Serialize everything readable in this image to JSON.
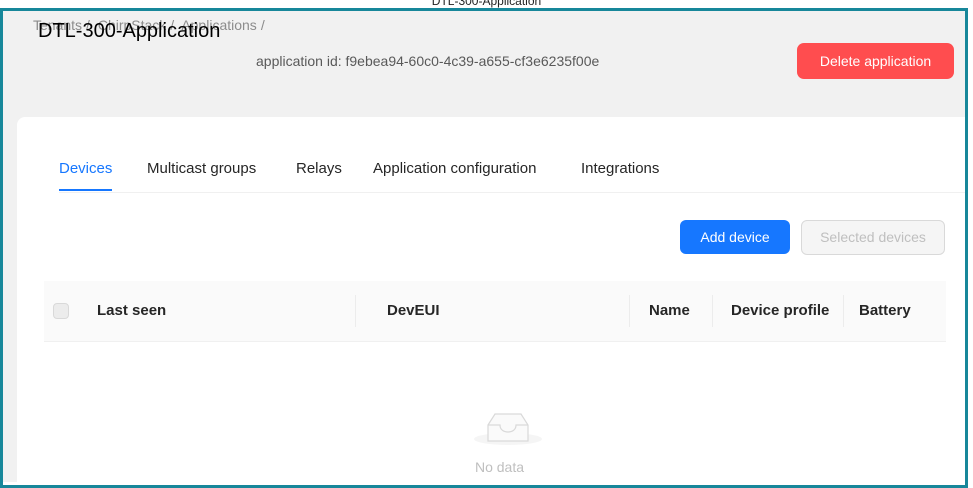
{
  "window": {
    "title": "DTL-300-Application"
  },
  "breadcrumb": {
    "items": [
      "Tenants",
      "/",
      "ChirpStack",
      "/",
      "Applications",
      "/"
    ]
  },
  "page": {
    "title": "DTL-300-Application",
    "application_id_label": "application id: f9ebea94-60c0-4c39-a655-cf3e6235f00e",
    "delete_button_label": "Delete application"
  },
  "tabs": [
    {
      "label": "Devices",
      "active": true
    },
    {
      "label": "Multicast groups",
      "active": false
    },
    {
      "label": "Relays",
      "active": false
    },
    {
      "label": "Application configuration",
      "active": false
    },
    {
      "label": "Integrations",
      "active": false
    }
  ],
  "actions": {
    "add_device_label": "Add device",
    "selected_devices_label": "Selected devices"
  },
  "table": {
    "columns": [
      "Last seen",
      "DevEUI",
      "Name",
      "Device profile",
      "Battery"
    ],
    "rows": []
  },
  "empty_state": {
    "icon": "inbox-icon",
    "text": "No data"
  },
  "colors": {
    "primary": "#1677ff",
    "danger": "#ff4d4f",
    "frame": "#17879a"
  }
}
